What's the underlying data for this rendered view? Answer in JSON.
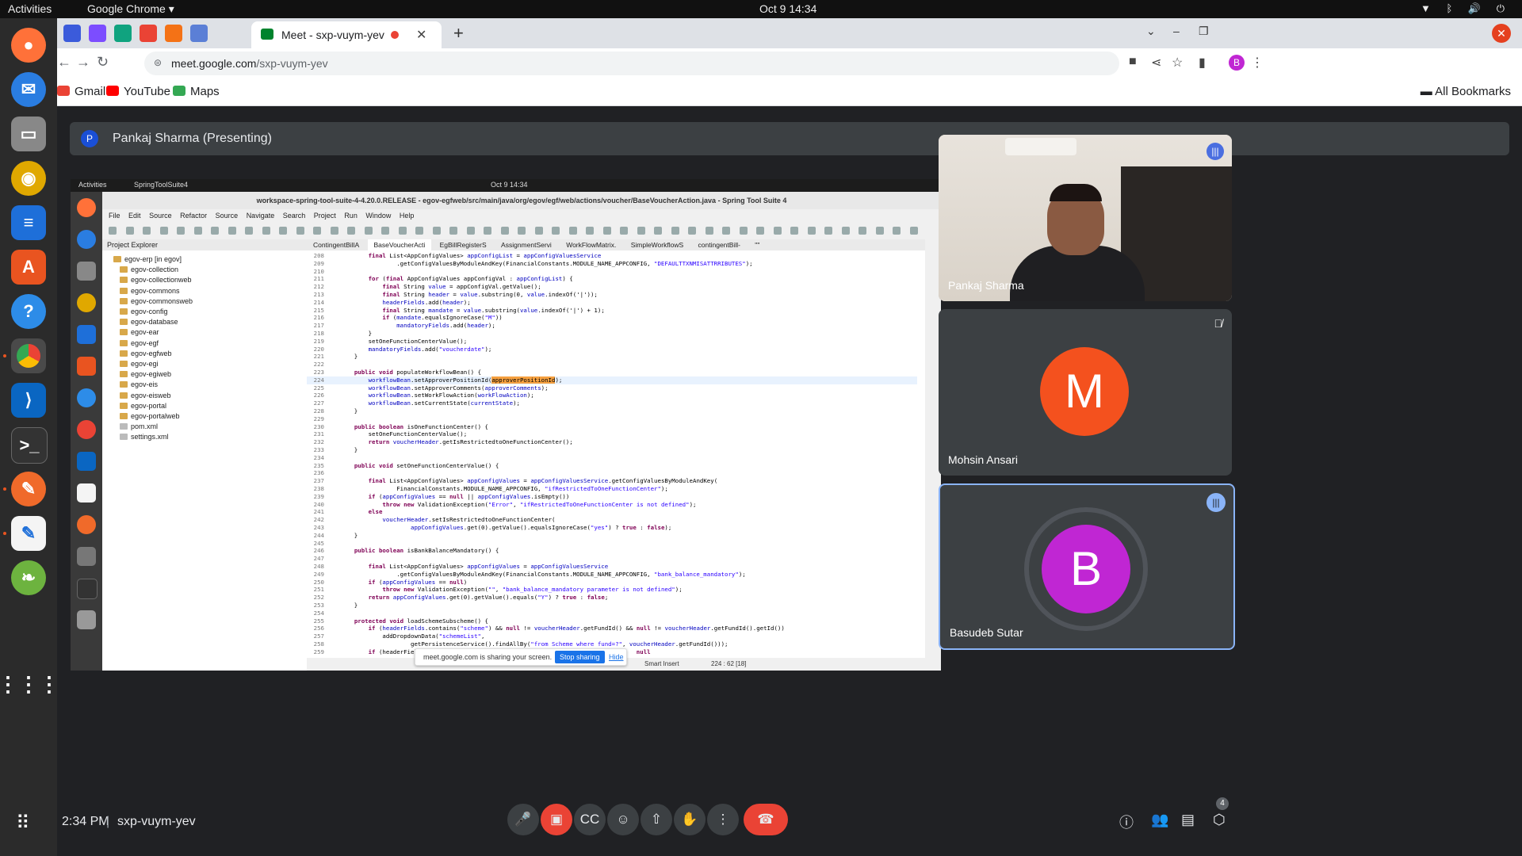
{
  "os": {
    "activities": "Activities",
    "app_name": "Google Chrome ▾",
    "clock": "Oct 9  14:34",
    "tray": "▼ ᛒ 🔊 ⏻"
  },
  "browser": {
    "active_tab_title": "Meet - sxp-vuym-yev",
    "url_host": "meet.google.com",
    "url_path": "/sxp-vuym-yev",
    "profile_initial": "B",
    "bookmarks": [
      "Gmail",
      "YouTube",
      "Maps"
    ],
    "all_bookmarks": "All Bookmarks"
  },
  "meet": {
    "presenter_initial": "P",
    "presenter_label": "Pankaj Sharma (Presenting)",
    "participants": [
      {
        "name": "Pankaj Sharma",
        "initial": ""
      },
      {
        "name": "Mohsin Ansari",
        "initial": "M",
        "color": "#f4511e"
      },
      {
        "name": "Basudeb Sutar",
        "initial": "B",
        "color": "#c026d3"
      }
    ],
    "time": "2:34 PM",
    "separator": "|",
    "meeting_code": "sxp-vuym-yev",
    "people_count": "4"
  },
  "shared": {
    "activities": "Activities",
    "app": "SpringToolSuite4",
    "clock": "Oct 9  14:34",
    "title": "workspace-spring-tool-suite-4-4.20.0.RELEASE - egov-egfweb/src/main/java/org/egov/egf/web/actions/voucher/BaseVoucherAction.java - Spring Tool Suite 4",
    "menu": [
      "File",
      "Edit",
      "Source",
      "Refactor",
      "Source",
      "Navigate",
      "Search",
      "Project",
      "Run",
      "Window",
      "Help"
    ],
    "explorer_title": "Project Explorer",
    "explorer_items": [
      "egov-erp [in egov]",
      "egov-collection",
      "egov-collectionweb",
      "egov-commons",
      "egov-commonsweb",
      "egov-config",
      "egov-database",
      "egov-ear",
      "egov-egf",
      "egov-egfweb",
      "egov-egi",
      "egov-egiweb",
      "egov-eis",
      "egov-eisweb",
      "egov-portal",
      "egov-portalweb",
      "pom.xml",
      "settings.xml"
    ],
    "editor_tabs": [
      "ContingentBillA",
      "BaseVoucherActi",
      "EgBillRegisterS",
      "AssignmentServi",
      "WorkFlowMatrix.",
      "SimpleWorkflowS",
      "contingentBill-",
      "\"\""
    ],
    "status_mode": "Smart Insert",
    "status_pos": "224 : 62 [18]",
    "share_msg": "meet.google.com is sharing your screen.",
    "stop_sharing": "Stop sharing",
    "hide": "Hide"
  },
  "code_lines": [
    [
      "208",
      "        final List<AppConfigValues> appConfigList = appConfigValuesService"
    ],
    [
      "209",
      "                .getConfigValuesByModuleAndKey(FinancialConstants.MODULE_NAME_APPCONFIG, \"DEFAULTTXNMISATTRRIBUTES\");"
    ],
    [
      "210",
      ""
    ],
    [
      "211",
      "        for (final AppConfigValues appConfigVal : appConfigList) {"
    ],
    [
      "212",
      "            final String value = appConfigVal.getValue();"
    ],
    [
      "213",
      "            final String header = value.substring(0, value.indexOf('|'));"
    ],
    [
      "214",
      "            headerFields.add(header);"
    ],
    [
      "215",
      "            final String mandate = value.substring(value.indexOf('|') + 1);"
    ],
    [
      "216",
      "            if (mandate.equalsIgnoreCase(\"M\"))"
    ],
    [
      "217",
      "                mandatoryFields.add(header);"
    ],
    [
      "218",
      "        }"
    ],
    [
      "219",
      "        setOneFunctionCenterValue();"
    ],
    [
      "220",
      "        mandatoryFields.add(\"voucherdate\");"
    ],
    [
      "221",
      "    }"
    ],
    [
      "222",
      ""
    ],
    [
      "223",
      "    public void populateWorkflowBean() {"
    ],
    [
      "224",
      "        workflowBean.setApproverPositionId(approverPositionId);"
    ],
    [
      "225",
      "        workflowBean.setApproverComments(approverComments);"
    ],
    [
      "226",
      "        workflowBean.setWorkFlowAction(workFlowAction);"
    ],
    [
      "227",
      "        workflowBean.setCurrentState(currentState);"
    ],
    [
      "228",
      "    }"
    ],
    [
      "229",
      ""
    ],
    [
      "230",
      "    public boolean isOneFunctionCenter() {"
    ],
    [
      "231",
      "        setOneFunctionCenterValue();"
    ],
    [
      "232",
      "        return voucherHeader.getIsRestrictedtoOneFunctionCenter();"
    ],
    [
      "233",
      "    }"
    ],
    [
      "234",
      ""
    ],
    [
      "235",
      "    public void setOneFunctionCenterValue() {"
    ],
    [
      "236",
      ""
    ],
    [
      "237",
      "        final List<AppConfigValues> appConfigValues = appConfigValuesService.getConfigValuesByModuleAndKey("
    ],
    [
      "238",
      "                FinancialConstants.MODULE_NAME_APPCONFIG, \"ifRestrictedToOneFunctionCenter\");"
    ],
    [
      "239",
      "        if (appConfigValues == null || appConfigValues.isEmpty())"
    ],
    [
      "240",
      "            throw new ValidationException(\"Error\", \"ifRestrictedToOneFunctionCenter is not defined\");"
    ],
    [
      "241",
      "        else"
    ],
    [
      "242",
      "            voucherHeader.setIsRestrictedtoOneFunctionCenter("
    ],
    [
      "243",
      "                    appConfigValues.get(0).getValue().equalsIgnoreCase(\"yes\") ? true : false);"
    ],
    [
      "244",
      "    }"
    ],
    [
      "245",
      ""
    ],
    [
      "246",
      "    public boolean isBankBalanceMandatory() {"
    ],
    [
      "247",
      ""
    ],
    [
      "248",
      "        final List<AppConfigValues> appConfigValues = appConfigValuesService"
    ],
    [
      "249",
      "                .getConfigValuesByModuleAndKey(FinancialConstants.MODULE_NAME_APPCONFIG, \"bank_balance_mandatory\");"
    ],
    [
      "250",
      "        if (appConfigValues == null)"
    ],
    [
      "251",
      "            throw new ValidationException(\"\", \"bank_balance_mandatory parameter is not defined\");"
    ],
    [
      "252",
      "        return appConfigValues.get(0).getValue().equals(\"Y\") ? true : false;"
    ],
    [
      "253",
      "    }"
    ],
    [
      "254",
      ""
    ],
    [
      "255",
      "    protected void loadSchemeSubscheme() {"
    ],
    [
      "256",
      "        if (headerFields.contains(\"scheme\") && null != voucherHeader.getFundId() && null != voucherHeader.getFundId().getId())"
    ],
    [
      "257",
      "            addDropdownData(\"schemeList\","
    ],
    [
      "258",
      "                    getPersistenceService().findAllBy(\"from Scheme where fund=?\", voucherHeader.getFundId()));"
    ],
    [
      "259",
      "        if (headerFiel                                                              null"
    ]
  ]
}
